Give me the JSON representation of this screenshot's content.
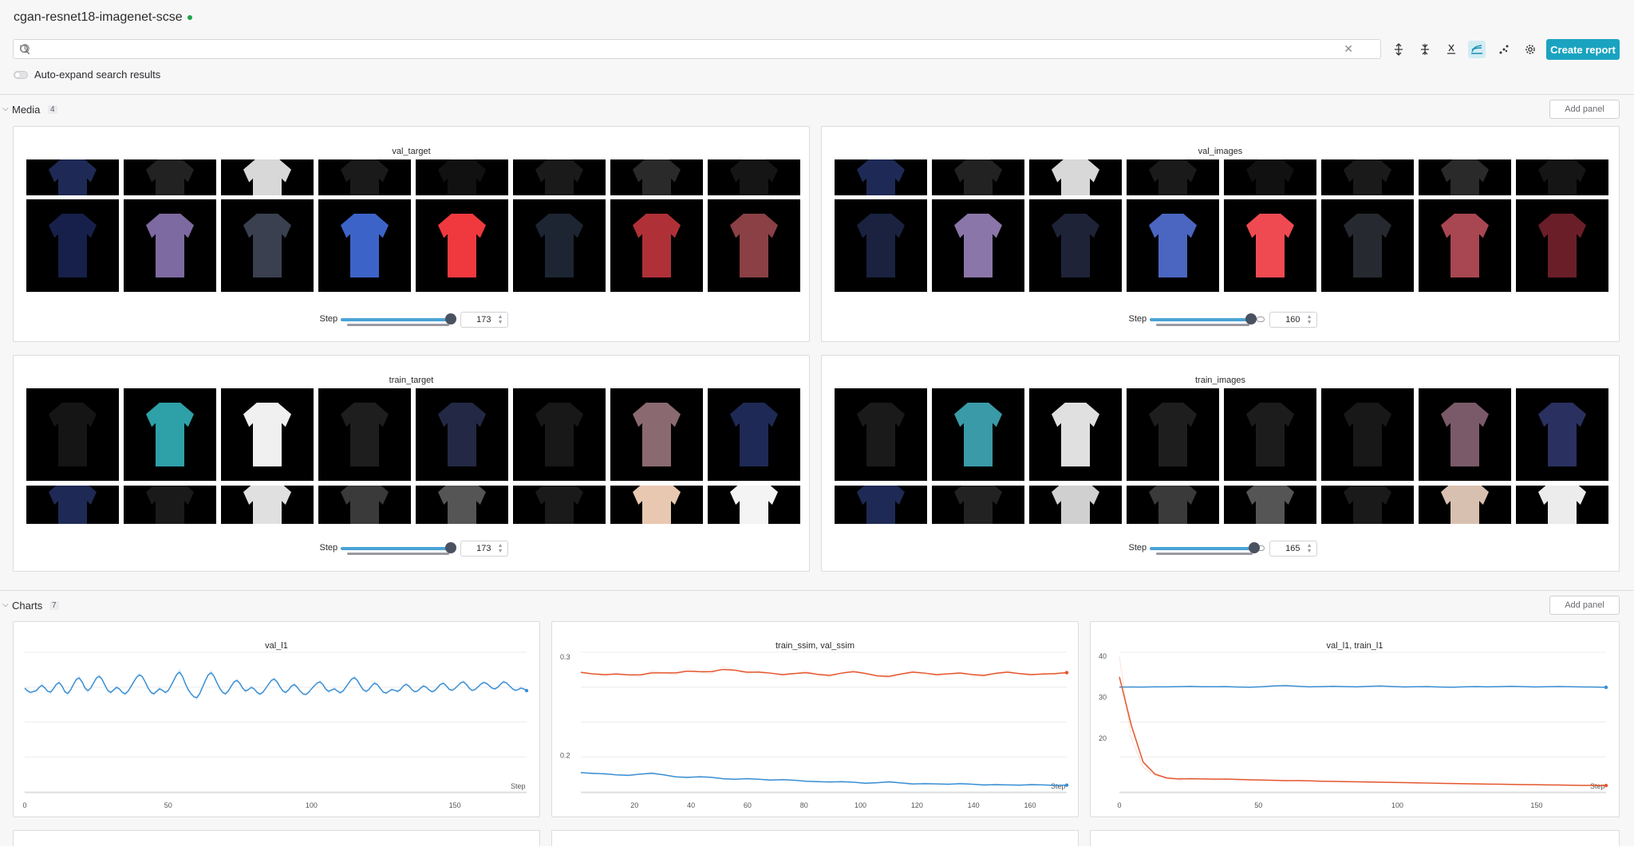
{
  "header": {
    "title": "cgan-resnet18-imagenet-scse",
    "status_color": "#1fa34a"
  },
  "search": {
    "placeholder": "",
    "value": ""
  },
  "toolbar": {
    "create_report": "Create report",
    "auto_expand_label": "Auto-expand search results"
  },
  "media": {
    "name": "Media",
    "count": "4",
    "add_panel": "Add panel",
    "panels": [
      {
        "title": "val_target",
        "step_label": "Step",
        "step": "173",
        "slider_fraction": 1.0,
        "top_row": [
          "#1e2a55",
          "#222",
          "#d8d8d8",
          "#1a1a1a",
          "#111",
          "#1a1a1a",
          "#2a2a2a",
          "#151515"
        ],
        "bottom_row": [
          "#16204a",
          "#7d6aa0",
          "#3a4050",
          "#3c64c8",
          "#f0393e",
          "#1d2533",
          "#b03038",
          "#8a4045"
        ]
      },
      {
        "title": "val_images",
        "step_label": "Step",
        "step": "160",
        "slider_fraction": 0.92,
        "top_row": [
          "#1e2a55",
          "#222",
          "#d8d8d8",
          "#1a1a1a",
          "#111",
          "#1a1a1a",
          "#2a2a2a",
          "#151515"
        ],
        "bottom_row": [
          "#1a2240",
          "#8a76a8",
          "#1e2338",
          "#4a66c0",
          "#ef4a52",
          "#262a30",
          "#a84652",
          "#6a1e28"
        ]
      },
      {
        "title": "train_target",
        "step_label": "Step",
        "step": "173",
        "slider_fraction": 1.0,
        "top_row": [
          "#151515",
          "#2ea0a8",
          "#f0f0f0",
          "#1e1e1e",
          "#232844",
          "#181818",
          "#8a6a70",
          "#1e2a55"
        ],
        "bottom_row": [
          "#1e2a55",
          "#1a1a1a",
          "#e0e0e0",
          "#3a3a3a",
          "#555",
          "#1a1a1a",
          "#e8c8b0",
          "#f4f4f4"
        ]
      },
      {
        "title": "train_images",
        "step_label": "Step",
        "step": "165",
        "slider_fraction": 0.95,
        "top_row": [
          "#1a1a1a",
          "#3a9aa8",
          "#e0e0e0",
          "#1e1e1e",
          "#1c1c1c",
          "#181818",
          "#7a5a68",
          "#2a3060"
        ],
        "bottom_row": [
          "#1e2a55",
          "#222",
          "#d0d0d0",
          "#3a3a3a",
          "#555",
          "#1a1a1a",
          "#d8c0b0",
          "#ececec"
        ]
      }
    ]
  },
  "charts": {
    "name": "Charts",
    "count": "7",
    "add_panel": "Add panel",
    "items": [
      {
        "title": "val_l1",
        "type": "line",
        "xlabel": "Step",
        "x_ticks": [
          "0",
          "50",
          "100",
          "150"
        ],
        "y_ticks": [],
        "colors": [
          "#3b8fd4"
        ]
      },
      {
        "title": "train_ssim, val_ssim",
        "type": "line",
        "xlabel": "Step",
        "x_ticks": [
          "20",
          "40",
          "60",
          "80",
          "100",
          "120",
          "140",
          "160"
        ],
        "y_ticks": [
          "0.3",
          "0.2"
        ],
        "colors": [
          "#e4572e",
          "#3b8fd4"
        ]
      },
      {
        "title": "val_l1, train_l1",
        "type": "line",
        "xlabel": "Step",
        "x_ticks": [
          "0",
          "50",
          "100",
          "150"
        ],
        "y_ticks": [
          "40",
          "30",
          "20"
        ],
        "colors": [
          "#3b8fd4",
          "#e4572e"
        ]
      }
    ]
  },
  "chart_data": [
    {
      "type": "line",
      "title": "val_l1",
      "xlabel": "Step",
      "ylabel": "",
      "xlim": [
        0,
        175
      ],
      "ylim": [
        0,
        1
      ],
      "series": [
        {
          "values": [
            0.75,
            0.72,
            0.7,
            0.73,
            0.71,
            0.75,
            0.78,
            0.74,
            0.72,
            0.7,
            0.74,
            0.77,
            0.8,
            0.76,
            0.71,
            0.69,
            0.73,
            0.77,
            0.81,
            0.83,
            0.79,
            0.74,
            0.71,
            0.74,
            0.78,
            0.82,
            0.84,
            0.81,
            0.76,
            0.72,
            0.7,
            0.73,
            0.76,
            0.74,
            0.71,
            0.69,
            0.72,
            0.75,
            0.79,
            0.82,
            0.85,
            0.83,
            0.79,
            0.74,
            0.71,
            0.69,
            0.72,
            0.75,
            0.73,
            0.7,
            0.72,
            0.76,
            0.8,
            0.84,
            0.88,
            0.83,
            0.77,
            0.73,
            0.7,
            0.68,
            0.66,
            0.7,
            0.75,
            0.8,
            0.84,
            0.87,
            0.83,
            0.78,
            0.74,
            0.71,
            0.69,
            0.72,
            0.76,
            0.79,
            0.81,
            0.78,
            0.74,
            0.71,
            0.73,
            0.76,
            0.74,
            0.71,
            0.69,
            0.71,
            0.74,
            0.77,
            0.8,
            0.82,
            0.79,
            0.75,
            0.72,
            0.7,
            0.73,
            0.76,
            0.78,
            0.75,
            0.72,
            0.7,
            0.69,
            0.71,
            0.74,
            0.76,
            0.78,
            0.8,
            0.77,
            0.73,
            0.71,
            0.73,
            0.75,
            0.72,
            0.7,
            0.72,
            0.75,
            0.78,
            0.81,
            0.83,
            0.8,
            0.76,
            0.73,
            0.71,
            0.73,
            0.76,
            0.79,
            0.77,
            0.74,
            0.71,
            0.7,
            0.72,
            0.74,
            0.73,
            0.71,
            0.73,
            0.76,
            0.78,
            0.76,
            0.73,
            0.71,
            0.72,
            0.74,
            0.77,
            0.75,
            0.73,
            0.71,
            0.72,
            0.75,
            0.77,
            0.79,
            0.76,
            0.73,
            0.72,
            0.74,
            0.76,
            0.78,
            0.8,
            0.77,
            0.74,
            0.72,
            0.73,
            0.75,
            0.77,
            0.79,
            0.78,
            0.76,
            0.74,
            0.73,
            0.75,
            0.77,
            0.8,
            0.78,
            0.76,
            0.74,
            0.72,
            0.73,
            0.75,
            0.74,
            0.72
          ]
        }
      ]
    },
    {
      "type": "line",
      "title": "train_ssim, val_ssim",
      "xlabel": "Step",
      "ylabel": "",
      "xlim": [
        1,
        173
      ],
      "ylim": [
        0.163,
        0.305
      ],
      "series": [
        {
          "values": [
            0.285,
            0.283,
            0.281,
            0.284,
            0.282,
            0.28,
            0.286,
            0.284,
            0.282,
            0.288,
            0.285,
            0.283,
            0.29,
            0.287,
            0.283,
            0.286,
            0.284,
            0.281,
            0.283,
            0.286,
            0.282,
            0.28,
            0.284,
            0.287,
            0.283,
            0.281,
            0.279,
            0.283,
            0.286,
            0.284,
            0.281,
            0.283,
            0.285,
            0.282,
            0.28,
            0.284,
            0.286,
            0.283,
            0.281,
            0.284,
            0.282,
            0.285
          ]
        },
        {
          "values": [
            0.183,
            0.181,
            0.182,
            0.18,
            0.179,
            0.181,
            0.183,
            0.18,
            0.178,
            0.177,
            0.179,
            0.178,
            0.176,
            0.175,
            0.177,
            0.176,
            0.174,
            0.176,
            0.175,
            0.173,
            0.174,
            0.172,
            0.174,
            0.173,
            0.171,
            0.172,
            0.174,
            0.172,
            0.17,
            0.172,
            0.171,
            0.17,
            0.172,
            0.171,
            0.169,
            0.171,
            0.17,
            0.169,
            0.171,
            0.17,
            0.169,
            0.17
          ]
        }
      ]
    },
    {
      "type": "line",
      "title": "val_l1, train_l1",
      "xlabel": "Step",
      "ylabel": "",
      "xlim": [
        0,
        175
      ],
      "ylim": [
        7,
        41
      ],
      "series": [
        {
          "values": [
            32.5,
            32.6,
            32.4,
            32.7,
            32.5,
            32.6,
            32.8,
            32.5,
            32.6,
            32.7,
            32.5,
            32.4,
            32.6,
            32.8,
            33.0,
            32.7,
            32.5,
            32.6,
            32.8,
            32.6,
            32.5,
            32.7,
            32.9,
            32.6,
            32.5,
            32.6,
            32.7,
            32.5,
            32.4,
            32.6,
            32.7,
            32.5,
            32.6,
            32.8,
            32.6,
            32.5,
            32.6,
            32.7,
            32.6,
            32.5,
            32.6,
            32.4
          ]
        },
        {
          "values": [
            40.0,
            20.0,
            13.0,
            11.0,
            10.2,
            10.0,
            10.3,
            10.1,
            10.0,
            10.2,
            9.9,
            10.0,
            9.8,
            9.9,
            9.6,
            9.8,
            9.7,
            9.5,
            9.6,
            9.4,
            9.5,
            9.3,
            9.4,
            9.2,
            9.3,
            9.1,
            9.2,
            9.0,
            9.1,
            8.9,
            9.0,
            8.8,
            8.9,
            8.8,
            8.7,
            8.8,
            8.6,
            8.7,
            8.6,
            8.5,
            8.6,
            8.5
          ]
        }
      ]
    }
  ]
}
